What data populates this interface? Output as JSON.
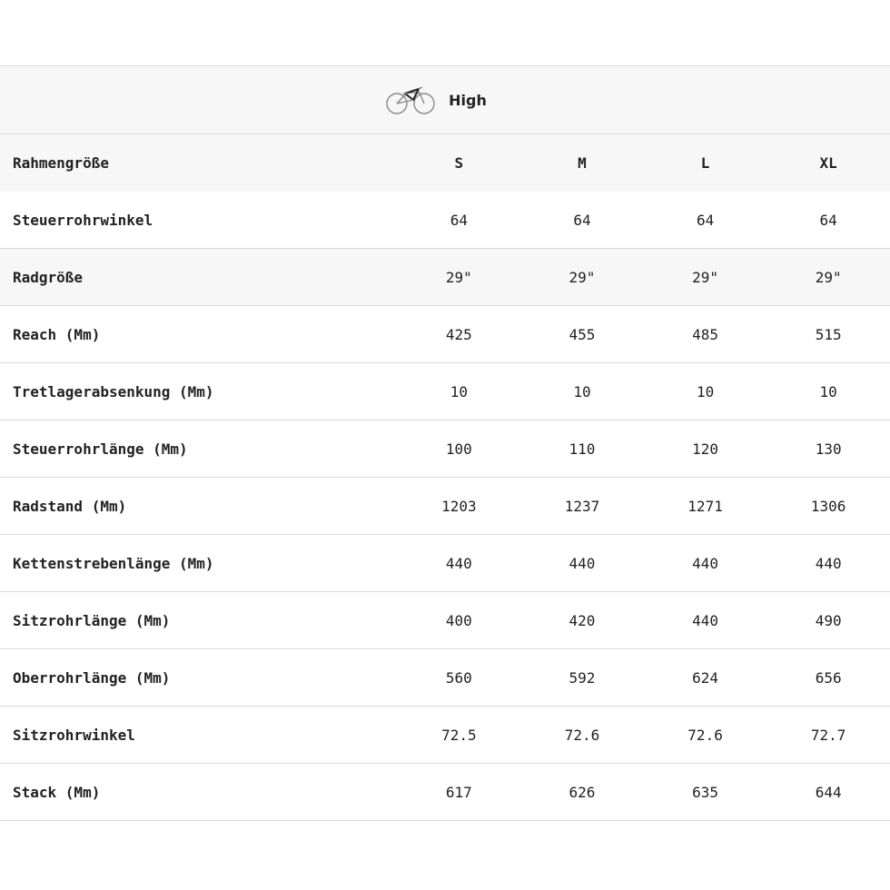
{
  "mode": {
    "label": "High",
    "icon": "bike-icon"
  },
  "table": {
    "header": {
      "label": "Rahmengröße",
      "sizes": [
        "S",
        "M",
        "L",
        "XL"
      ]
    },
    "rows": [
      {
        "label": "Steuerrohrwinkel",
        "values": [
          "64",
          "64",
          "64",
          "64"
        ]
      },
      {
        "label": "Radgröße",
        "values": [
          "29\"",
          "29\"",
          "29\"",
          "29\""
        ]
      },
      {
        "label": "Reach (Mm)",
        "values": [
          "425",
          "455",
          "485",
          "515"
        ]
      },
      {
        "label": "Tretlagerabsenkung (Mm)",
        "values": [
          "10",
          "10",
          "10",
          "10"
        ]
      },
      {
        "label": "Steuerrohrlänge (Mm)",
        "values": [
          "100",
          "110",
          "120",
          "130"
        ]
      },
      {
        "label": "Radstand (Mm)",
        "values": [
          "1203",
          "1237",
          "1271",
          "1306"
        ]
      },
      {
        "label": "Kettenstrebenlänge (Mm)",
        "values": [
          "440",
          "440",
          "440",
          "440"
        ]
      },
      {
        "label": "Sitzrohrlänge (Mm)",
        "values": [
          "400",
          "420",
          "440",
          "490"
        ]
      },
      {
        "label": "Oberrohrlänge (Mm)",
        "values": [
          "560",
          "592",
          "624",
          "656"
        ]
      },
      {
        "label": "Sitzrohrwinkel",
        "values": [
          "72.5",
          "72.6",
          "72.6",
          "72.7"
        ]
      },
      {
        "label": "Stack (Mm)",
        "values": [
          "617",
          "626",
          "635",
          "644"
        ]
      }
    ]
  }
}
